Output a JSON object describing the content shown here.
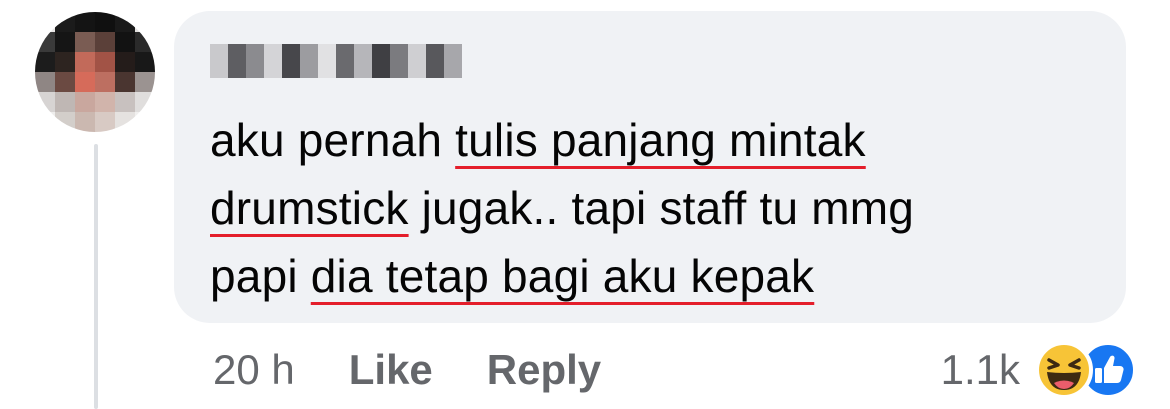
{
  "comment": {
    "author_name_redacted": "",
    "text_lines": [
      {
        "plain_before": "aku pernah ",
        "underlined": "tulis panjang mintak",
        "plain_after": ""
      },
      {
        "plain_before": "",
        "underlined": "drumstick",
        "plain_after": " jugak.. tapi staff tu mmg"
      },
      {
        "plain_before": "papi ",
        "underlined": "dia tetap bagi aku kepak",
        "plain_after": ""
      }
    ],
    "underline_color": "#e41e2b"
  },
  "actions": {
    "timestamp": "20 h",
    "like_label": "Like",
    "reply_label": "Reply"
  },
  "reactions": {
    "count": "1.1k",
    "icons": [
      "haha-emoji-icon",
      "like-thumb-icon"
    ]
  },
  "colors": {
    "bubble_bg": "#f0f2f5",
    "text": "#050505",
    "meta": "#65676b",
    "like_blue": "#1877f2",
    "haha_yellow": "#f7c437"
  }
}
